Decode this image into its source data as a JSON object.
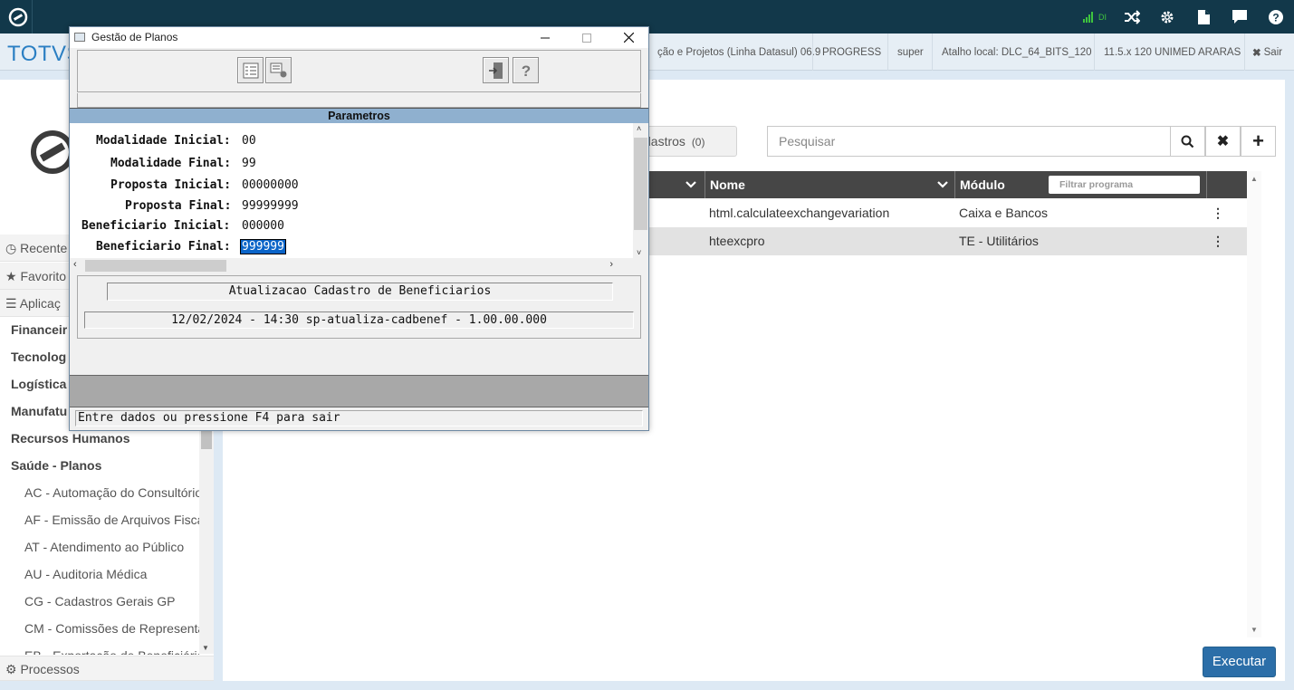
{
  "topbar": {
    "signal_label": "DI"
  },
  "subbar": {
    "brand": "TOTVS",
    "info": [
      "ção e Projetos (Linha Datasul) 06.9",
      "PROGRESS",
      "super",
      "Atalho local: DLC_64_BITS_120",
      "11.5.x 120 UNIMED ARARAS"
    ],
    "exit_label": "Sair"
  },
  "left_nav": {
    "headers": [
      "Recente",
      "Favorito",
      "Aplicaç"
    ],
    "categories": [
      "Financeir",
      "Tecnolog",
      "Logística",
      "Manufatu",
      "Recursos Humanos",
      "Saúde - Planos"
    ],
    "subitems": [
      "AC - Automação do Consultório",
      "AF - Emissão de Arquivos Fiscais",
      "AT - Atendimento ao Público",
      "AU - Auditoria Médica",
      "CG - Cadastros Gerais GP",
      "CM - Comissões de Representantes",
      "EB - Exportação de Beneficiários"
    ],
    "footer": "Processos"
  },
  "main": {
    "cadastros_label": "dastros",
    "cadastros_count": "(0)",
    "search_placeholder": "Pesquisar",
    "columns": {
      "nome": "Nome",
      "modulo": "Módulo",
      "filter_placeholder": "Filtrar programa"
    },
    "rows": [
      {
        "nome": "html.calculateexchangevariation",
        "modulo": "Caixa e Bancos"
      },
      {
        "nome": "hteexcpro",
        "modulo": "TE - Utilitários"
      }
    ],
    "execute_label": "Executar"
  },
  "dialog": {
    "title": "Gestão de Planos",
    "params_title": "Parametros",
    "params": [
      {
        "label": "Modalidade Inicial:",
        "value": "00"
      },
      {
        "label": "Modalidade Final:",
        "value": "99"
      },
      {
        "label": "Proposta Inicial:",
        "value": "00000000"
      },
      {
        "label": "Proposta Final:",
        "value": "99999999"
      },
      {
        "label": "Beneficiario Inicial:",
        "value": "000000"
      },
      {
        "label": "Beneficiario Final:",
        "value": "999999"
      }
    ],
    "process_title": "Atualizacao Cadastro de Beneficiarios",
    "process_info": "12/02/2024 - 14:30  sp-atualiza-cadbenef - 1.00.00.000",
    "status_message": "Entre dados ou pressione F4 para sair"
  },
  "colors": {
    "topbar": "#12384a",
    "brand": "#2b7fc3",
    "params_header": "#8fb0cf",
    "execute_button": "#2b6ea8",
    "selection": "#0a64c8"
  }
}
